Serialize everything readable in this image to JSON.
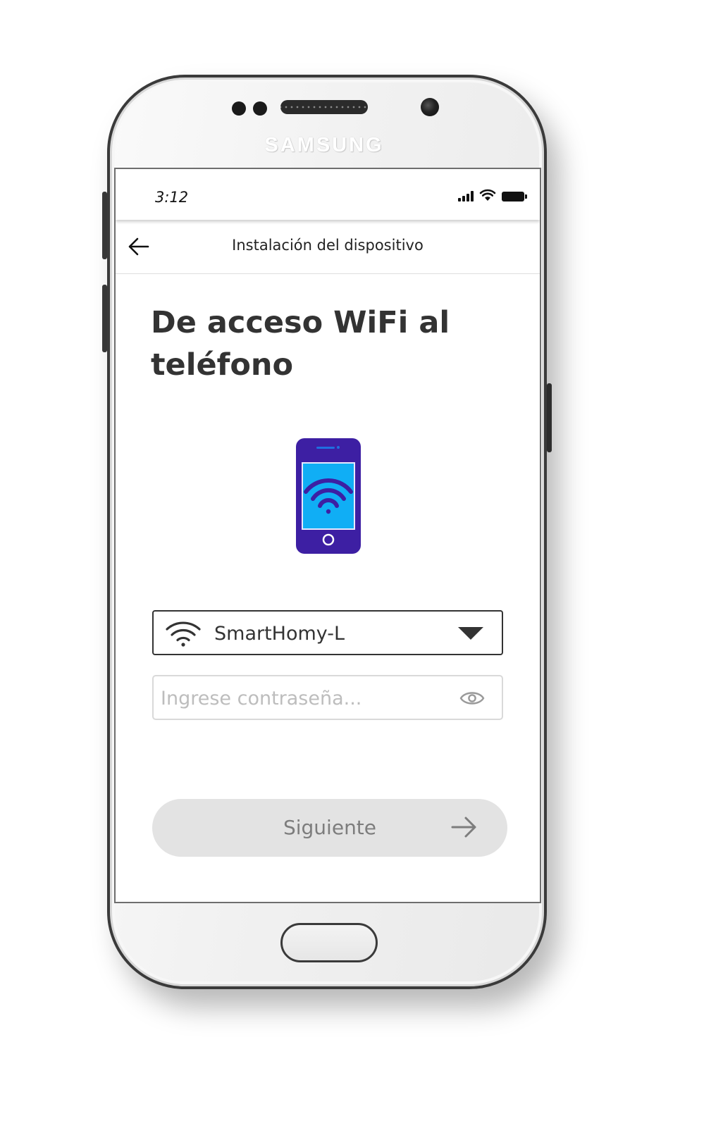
{
  "device": {
    "brand": "SAMSUNG"
  },
  "status_bar": {
    "time": "3:12",
    "icons": [
      "signal-icon",
      "wifi-icon",
      "battery-icon"
    ]
  },
  "app_bar": {
    "back_icon": "arrow-left-icon",
    "title": "Instalación del dispositivo"
  },
  "main": {
    "heading": "De acceso WiFi al teléfono",
    "illustration_icon": "phone-wifi-icon",
    "network_select": {
      "icon": "wifi-icon",
      "value": "SmartHomy-L",
      "caret_icon": "caret-down-icon"
    },
    "password": {
      "placeholder": "Ingrese contraseña...",
      "value": "",
      "toggle_icon": "eye-icon"
    },
    "next_button": {
      "label": "Siguiente",
      "icon": "arrow-right-icon"
    }
  },
  "colors": {
    "heading": "#333333",
    "illustration_body": "#3d1fa3",
    "illustration_screen": "#10aef5",
    "button_disabled_bg": "#e3e3e3",
    "button_disabled_text": "#7d7d7d",
    "placeholder": "#bdbdbd"
  }
}
